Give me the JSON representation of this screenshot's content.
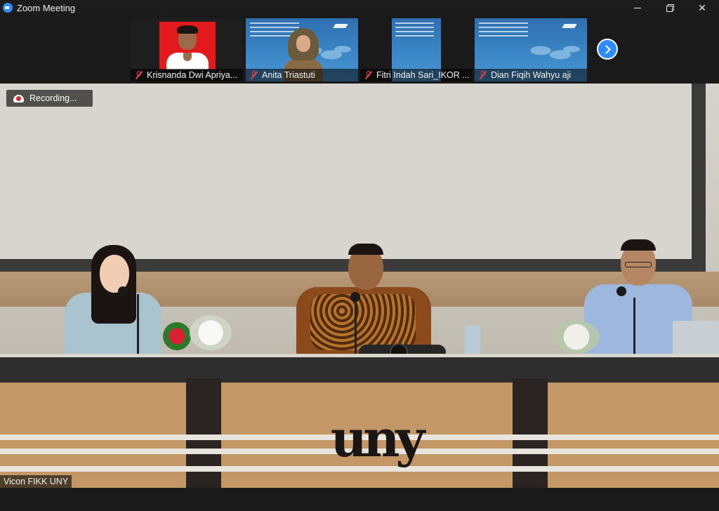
{
  "window": {
    "title": "Zoom Meeting",
    "app_icon": "zoom-icon"
  },
  "participants": [
    {
      "name": "Krisnanda Dwi Apriya...",
      "muted": true,
      "video": "portrait"
    },
    {
      "name": "Anita Triastuti",
      "muted": true,
      "video": "virtual-background"
    },
    {
      "name": "Fitri Indah Sari_IKOR ...",
      "muted": true,
      "video": "virtual-background"
    },
    {
      "name": "Dian Fiqih Wahyu aji",
      "muted": true,
      "video": "virtual-background"
    }
  ],
  "strip": {
    "next_icon": "chevron-right-icon"
  },
  "main": {
    "recording_label": "Recording...",
    "speaker_name": "Vicon FIKK UNY"
  },
  "colors": {
    "zoom_blue": "#2d8cff",
    "muted_red": "#e8414b",
    "record_red": "#e02828",
    "background": "#1a1a1a"
  }
}
